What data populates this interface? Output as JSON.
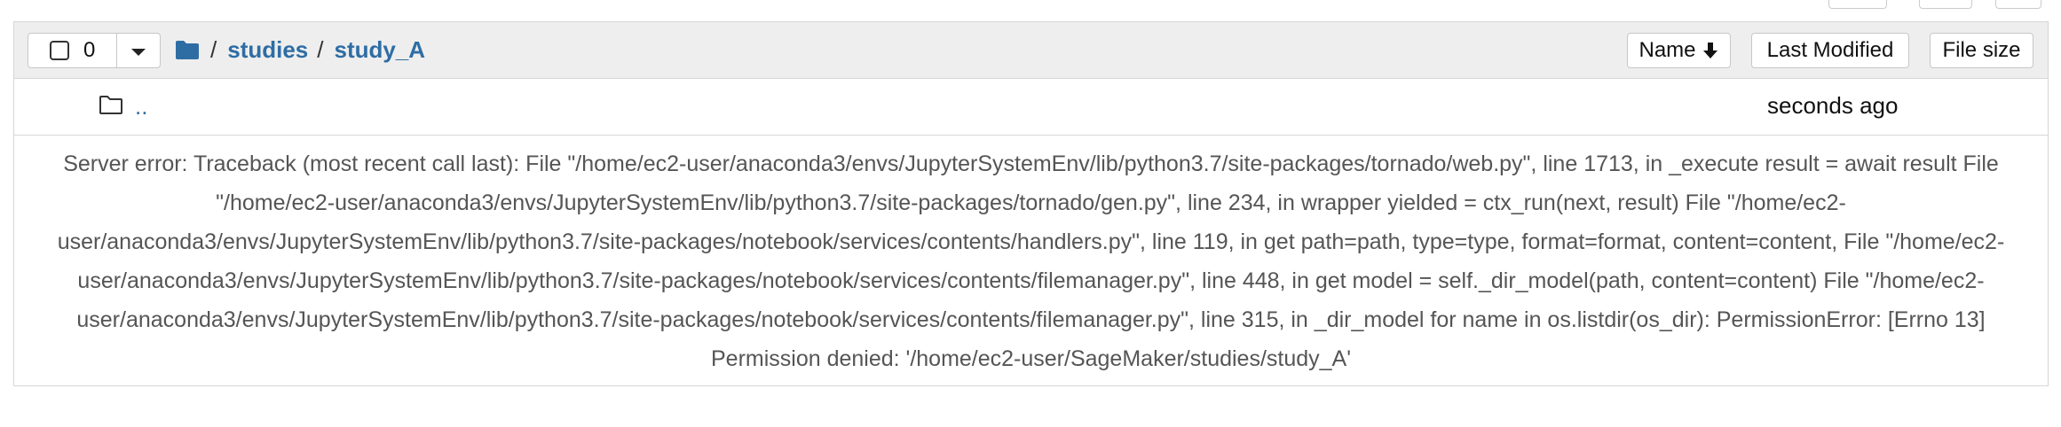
{
  "header": {
    "selected_count": "0",
    "breadcrumb": [
      "studies",
      "study_A"
    ],
    "separator": "/",
    "sort_buttons": {
      "name": "Name",
      "last_modified": "Last Modified",
      "file_size": "File size"
    }
  },
  "parent_row": {
    "label": "..",
    "modified": "seconds ago"
  },
  "error_message": "Server error: Traceback (most recent call last): File \"/home/ec2-user/anaconda3/envs/JupyterSystemEnv/lib/python3.7/site-packages/tornado/web.py\", line 1713, in _execute result = await result File \"/home/ec2-user/anaconda3/envs/JupyterSystemEnv/lib/python3.7/site-packages/tornado/gen.py\", line 234, in wrapper yielded = ctx_run(next, result) File \"/home/ec2-user/anaconda3/envs/JupyterSystemEnv/lib/python3.7/site-packages/notebook/services/contents/handlers.py\", line 119, in get path=path, type=type, format=format, content=content, File \"/home/ec2-user/anaconda3/envs/JupyterSystemEnv/lib/python3.7/site-packages/notebook/services/contents/filemanager.py\", line 448, in get model = self._dir_model(path, content=content) File \"/home/ec2-user/anaconda3/envs/JupyterSystemEnv/lib/python3.7/site-packages/notebook/services/contents/filemanager.py\", line 315, in _dir_model for name in os.listdir(os_dir): PermissionError: [Errno 13] Permission denied: '/home/ec2-user/SageMaker/studies/study_A'",
  "icons": {
    "root_folder": "folder-solid-icon",
    "parent_folder": "folder-outline-icon",
    "sort_direction": "arrow-down-icon",
    "dropdown": "caret-down-icon"
  },
  "colors": {
    "link": "#2e6da4",
    "header_bg": "#eeeeee",
    "border": "#d6d6d6",
    "error_text": "#555555"
  }
}
